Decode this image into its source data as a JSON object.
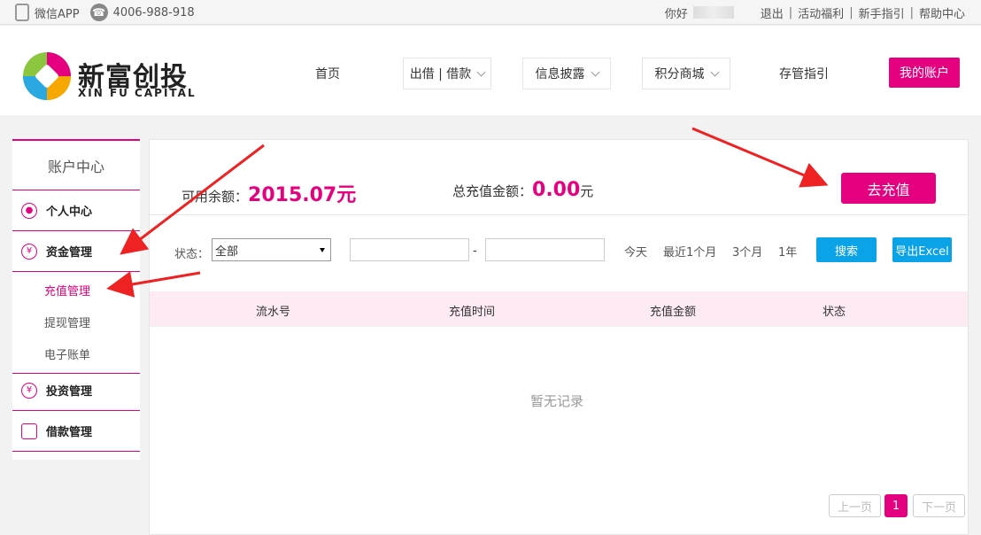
{
  "topbar": {
    "wechat_app": "微信APP",
    "phone": "4006-988-918",
    "greeting": "你好",
    "links": [
      "退出",
      "活动福利",
      "新手指引",
      "帮助中心"
    ],
    "separator": "|"
  },
  "brand": {
    "name_cn": "新富创投",
    "name_en": "XIN FU CAPITAL"
  },
  "nav": {
    "home": "首页",
    "lend_borrow": "出借 | 借款",
    "disclosure": "信息披露",
    "points_mall": "积分商城",
    "custody": "存管指引",
    "my_account": "我的账户"
  },
  "sidebar": {
    "title": "账户中心",
    "personal": "个人中心",
    "funds": "资金管理",
    "funds_sub": [
      "充值管理",
      "提现管理",
      "电子账单"
    ],
    "investment": "投资管理",
    "loan": "借款管理",
    "icons": {
      "funds": "¥",
      "investment": "¥"
    }
  },
  "summary": {
    "available_label": "可用余额：",
    "available_value": "2015.07",
    "available_unit": "元",
    "total_label": "总充值金额：",
    "total_value": "0.00",
    "total_unit": "元",
    "recharge_button": "去充值"
  },
  "filter": {
    "status_label": "状态：",
    "status_selected": "全部",
    "range_separator": "-",
    "quick_ranges": [
      "今天",
      "最近1个月",
      "3个月",
      "1年"
    ],
    "search_button": "搜索",
    "export_button": "导出Excel"
  },
  "table": {
    "columns": [
      "流水号",
      "充值时间",
      "充值金额",
      "状态"
    ],
    "empty_text": "暂无记录"
  },
  "pagination": {
    "prev": "上一页",
    "current": "1",
    "next": "下一页"
  },
  "colors": {
    "accent": "#e4007f",
    "button_blue": "#0aa3e8",
    "annotation_arrow": "#ee2222"
  }
}
